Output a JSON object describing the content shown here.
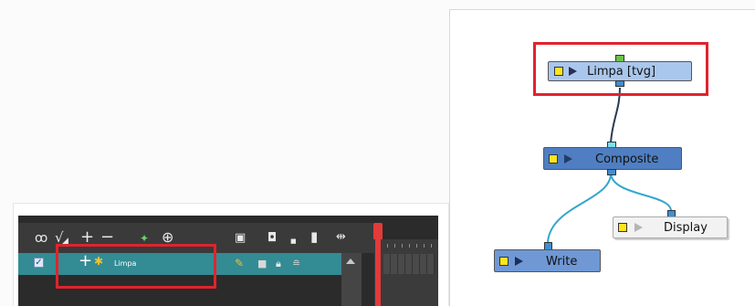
{
  "timeline": {
    "layer_name": "Limpa",
    "layer_checked": true,
    "toolbar_icons": [
      "onion-skin-icon",
      "show-all-icon",
      "add-layer-icon",
      "remove-layer-icon",
      "add-peg-icon",
      "add-drawing-icon",
      "display-icon",
      "solo-icon",
      "small-square-icon",
      "white-rect-icon",
      "split-icon"
    ]
  },
  "node_view": {
    "nodes": {
      "limpa": {
        "label": "Limpa  [tvg]"
      },
      "composite": {
        "label": "Composite"
      },
      "display": {
        "label": "Display"
      },
      "write": {
        "label": "Write"
      }
    }
  },
  "colors": {
    "highlight_red": "#e0242c",
    "drawing_node": "#a9c7ec",
    "composite_node": "#4f7fc2",
    "write_node": "#6f98d5",
    "display_node": "#f2f2f2",
    "layer_row": "#338b94",
    "cable": "#34a6cf"
  }
}
